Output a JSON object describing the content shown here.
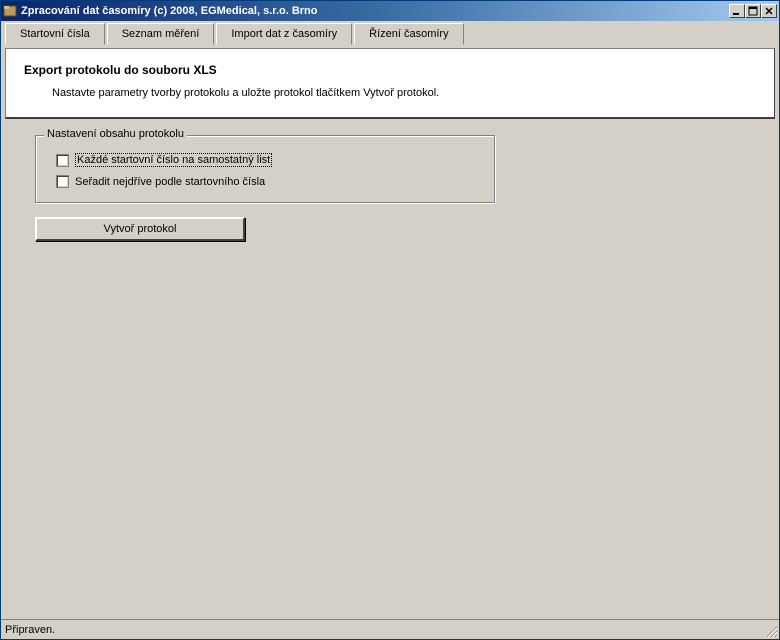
{
  "window": {
    "title": "Zpracování dat časomíry (c) 2008, EGMedical, s.r.o. Brno"
  },
  "tabs": [
    {
      "label": "Startovní čísla"
    },
    {
      "label": "Seznam měření"
    },
    {
      "label": "Import dat z časomíry"
    },
    {
      "label": "Řízení časomíry"
    }
  ],
  "header": {
    "title": "Export protokolu do souboru XLS",
    "text": "Nastavte parametry tvorby protokolu a uložte protokol tlačítkem Vytvoř protokol."
  },
  "groupbox": {
    "legend": "Nastavení obsahu protokolu",
    "checkboxes": [
      {
        "label": "Každé startovní číslo na samostatný list",
        "checked": false,
        "focused": true
      },
      {
        "label": "Seřadit nejdříve podle startovního čísla",
        "checked": false,
        "focused": false
      }
    ]
  },
  "action_button": {
    "label": "Vytvoř protokol"
  },
  "statusbar": {
    "text": "Připraven."
  }
}
